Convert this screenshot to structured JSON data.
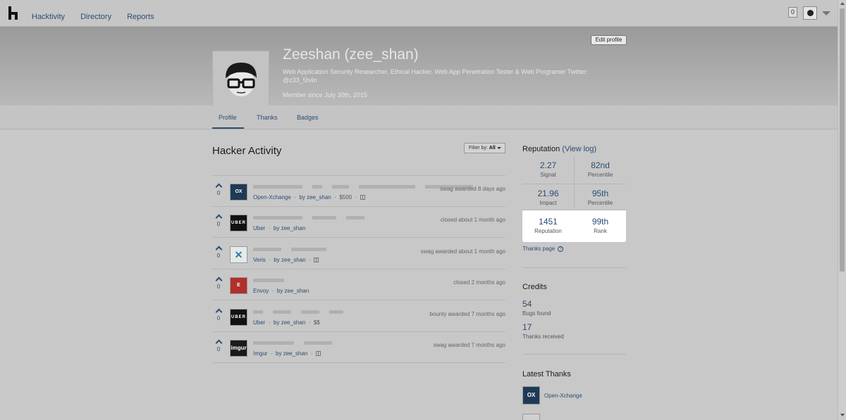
{
  "nav": {
    "items": [
      "Hacktivity",
      "Directory",
      "Reports"
    ],
    "notification_count": "0"
  },
  "profile": {
    "edit_label": "Edit profile",
    "name": "Zeeshan (zee_shan)",
    "bio": "Web Application Security Researcher, Ethical Hacker, Web App Penetration Tester & Web Programer  Twitter: @z33_5h4n",
    "member_since": "Member since July 30th, 2015"
  },
  "tabs": [
    "Profile",
    "Thanks",
    "Badges"
  ],
  "activity": {
    "title": "Hacker Activity",
    "filter_label": "Filter by:",
    "filter_value": "All",
    "rows": [
      {
        "votes": "0",
        "program": "Open-Xchange",
        "logo_text": "OX",
        "logo_color": "#1f3a55",
        "by": "by zee_shan",
        "extra": "$500",
        "gift": true,
        "status": "swag awarded 8 days ago"
      },
      {
        "votes": "0",
        "program": "Uber",
        "logo_text": "UBER",
        "logo_color": "#111111",
        "by": "by zee_shan",
        "extra": "",
        "gift": false,
        "status": "closed about 1 month ago"
      },
      {
        "votes": "0",
        "program": "Veris",
        "logo_text": "✕",
        "logo_color": "#e8e8e8",
        "by": "by zee_shan",
        "extra": "",
        "gift": true,
        "status": "swag awarded about 1 month ago"
      },
      {
        "votes": "0",
        "program": "Envoy",
        "logo_text": "E",
        "logo_color": "#b0302c",
        "by": "by zee_shan",
        "extra": "",
        "gift": false,
        "status": "closed 2 months ago"
      },
      {
        "votes": "0",
        "program": "Uber",
        "logo_text": "UBER",
        "logo_color": "#111111",
        "by": "by zee_shan",
        "extra": "$$",
        "gift": false,
        "status": "bounty awarded 7 months ago"
      },
      {
        "votes": "0",
        "program": "Imgur",
        "logo_text": "imgur",
        "logo_color": "#1a1a1a",
        "by": "by zee_shan",
        "extra": "",
        "gift": true,
        "status": "swag awarded 7 months ago"
      }
    ]
  },
  "reputation": {
    "title": "Reputation",
    "view_log": "(View log)",
    "stats": [
      {
        "value": "2.27",
        "label": "Signal"
      },
      {
        "value": "82nd",
        "label": "Percentile"
      },
      {
        "value": "21.96",
        "label": "Impact"
      },
      {
        "value": "95th",
        "label": "Percentile"
      },
      {
        "value": "1451",
        "label": "Reputation"
      },
      {
        "value": "99th",
        "label": "Rank"
      }
    ],
    "thanks_page": "Thanks page"
  },
  "credits": {
    "title": "Credits",
    "bugs_found_value": "54",
    "bugs_found_label": "Bugs found",
    "thanks_value": "17",
    "thanks_label": "Thanks received"
  },
  "latest_thanks": {
    "title": "Latest Thanks",
    "items": [
      {
        "name": "Open-Xchange",
        "logo_text": "OX"
      }
    ]
  }
}
